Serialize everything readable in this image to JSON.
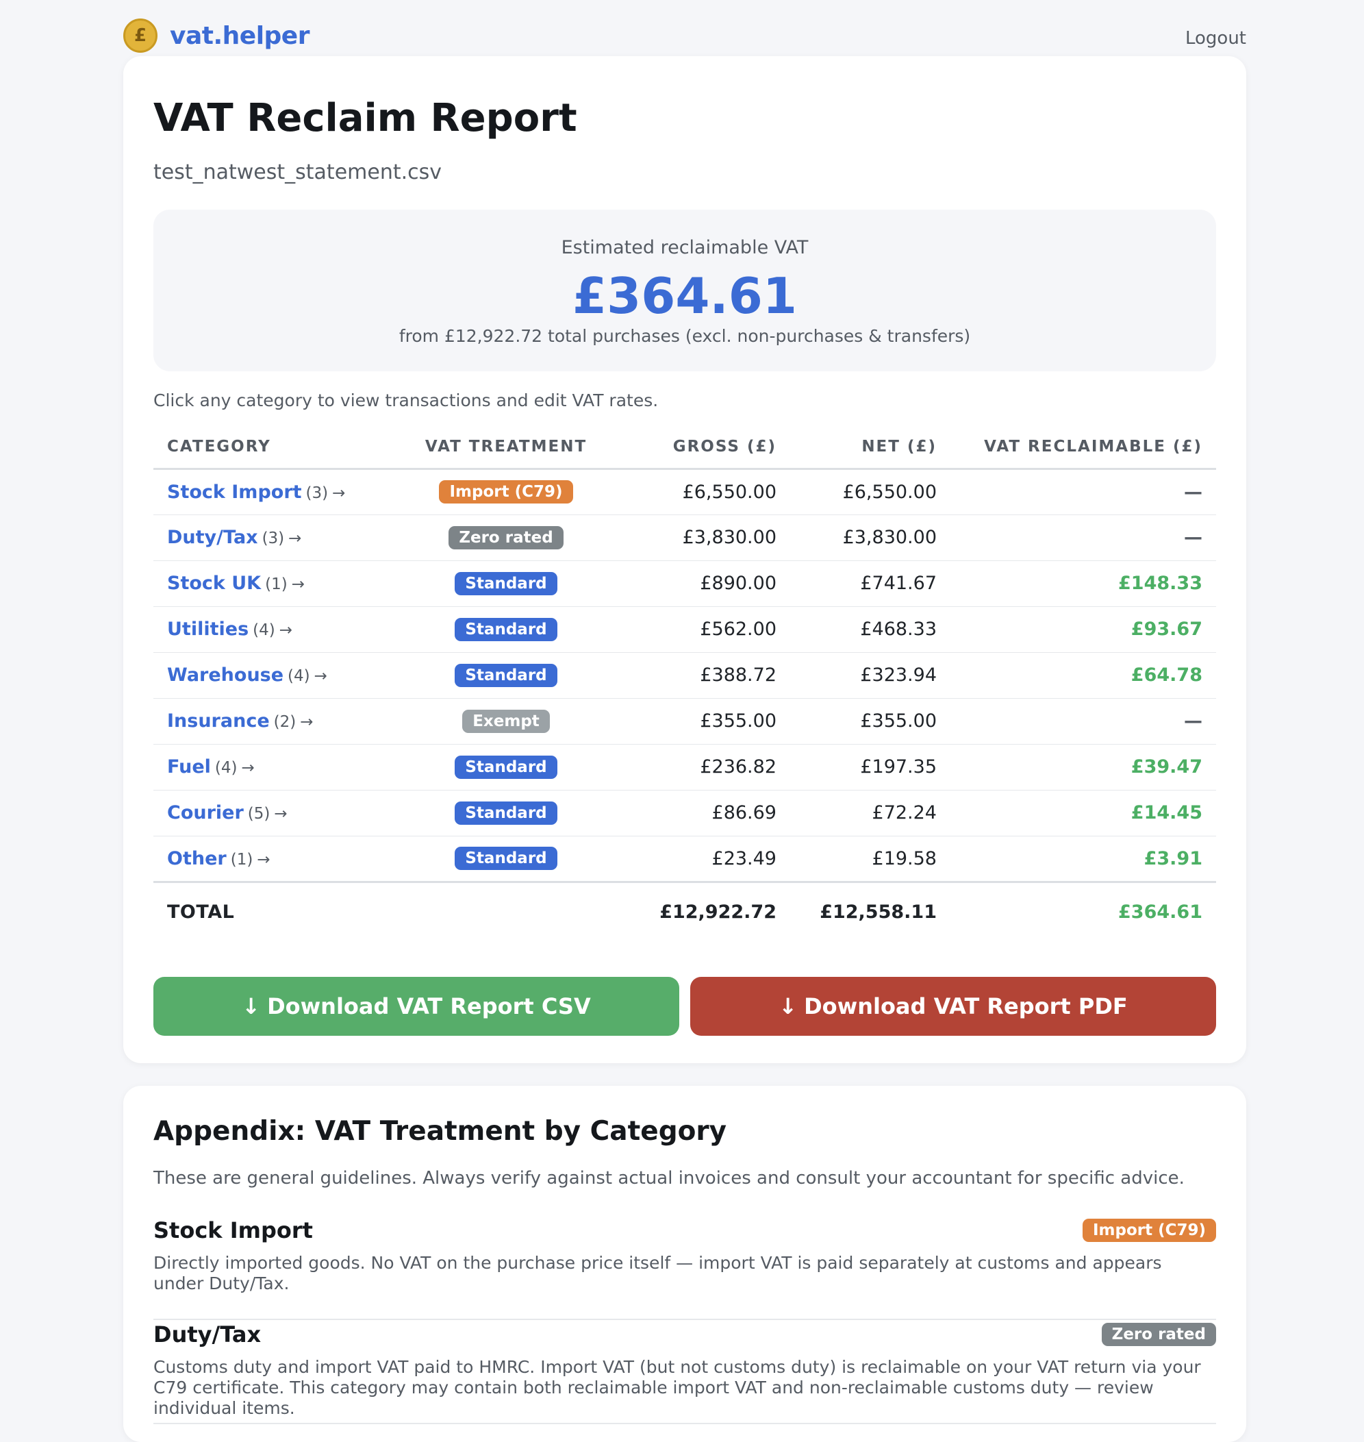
{
  "header": {
    "brand_icon": "£",
    "brand_name": "vat.helper",
    "logout_label": "Logout"
  },
  "report": {
    "title": "VAT Reclaim Report",
    "filename": "test_natwest_statement.csv"
  },
  "summary": {
    "label": "Estimated reclaimable VAT",
    "amount": "£364.61",
    "subtext": "from £12,922.72 total purchases (excl. non-purchases & transfers)"
  },
  "hint": "Click any category to view transactions and edit VAT rates.",
  "table": {
    "headers": {
      "category": "CATEGORY",
      "treatment": "VAT TREATMENT",
      "gross": "GROSS (£)",
      "net": "NET (£)",
      "vat": "VAT RECLAIMABLE (£)"
    },
    "rows": [
      {
        "category": "Stock Import",
        "count": "(3)",
        "treatment": "Import (C79)",
        "gross": "£6,550.00",
        "net": "£6,550.00",
        "vat": "—"
      },
      {
        "category": "Duty/Tax",
        "count": "(3)",
        "treatment": "Zero rated",
        "gross": "£3,830.00",
        "net": "£3,830.00",
        "vat": "—"
      },
      {
        "category": "Stock UK",
        "count": "(1)",
        "treatment": "Standard",
        "gross": "£890.00",
        "net": "£741.67",
        "vat": "£148.33"
      },
      {
        "category": "Utilities",
        "count": "(4)",
        "treatment": "Standard",
        "gross": "£562.00",
        "net": "£468.33",
        "vat": "£93.67"
      },
      {
        "category": "Warehouse",
        "count": "(4)",
        "treatment": "Standard",
        "gross": "£388.72",
        "net": "£323.94",
        "vat": "£64.78"
      },
      {
        "category": "Insurance",
        "count": "(2)",
        "treatment": "Exempt",
        "gross": "£355.00",
        "net": "£355.00",
        "vat": "—"
      },
      {
        "category": "Fuel",
        "count": "(4)",
        "treatment": "Standard",
        "gross": "£236.82",
        "net": "£197.35",
        "vat": "£39.47"
      },
      {
        "category": "Courier",
        "count": "(5)",
        "treatment": "Standard",
        "gross": "£86.69",
        "net": "£72.24",
        "vat": "£14.45"
      },
      {
        "category": "Other",
        "count": "(1)",
        "treatment": "Standard",
        "gross": "£23.49",
        "net": "£19.58",
        "vat": "£3.91"
      }
    ],
    "row_arrow": "→",
    "total": {
      "label": "TOTAL",
      "gross": "£12,922.72",
      "net": "£12,558.11",
      "vat": "£364.61"
    }
  },
  "actions": {
    "download_arrow": "↓",
    "csv_label": "Download VAT Report CSV",
    "pdf_label": "Download VAT Report PDF"
  },
  "appendix": {
    "title": "Appendix: VAT Treatment by Category",
    "intro": "These are general guidelines. Always verify against actual invoices and consult your accountant for specific advice.",
    "items": [
      {
        "name": "Stock Import",
        "badge": "Import (C79)",
        "description": "Directly imported goods. No VAT on the purchase price itself — import VAT is paid separately at customs and appears under Duty/Tax."
      },
      {
        "name": "Duty/Tax",
        "badge": "Zero rated",
        "description": "Customs duty and import VAT paid to HMRC. Import VAT (but not customs duty) is reclaimable on your VAT return via your C79 certificate. This category may contain both reclaimable import VAT and non-reclaimable customs duty — review individual items."
      }
    ]
  },
  "colors": {
    "accent_blue": "#3b6bd4",
    "reclaim_green": "#4caf64",
    "badge_import": "#e0823b",
    "badge_zero": "#7d8488",
    "badge_standard": "#3b6bd4",
    "badge_exempt": "#9ba2a6",
    "csv_button": "#57ad6a",
    "pdf_button": "#b34436"
  }
}
